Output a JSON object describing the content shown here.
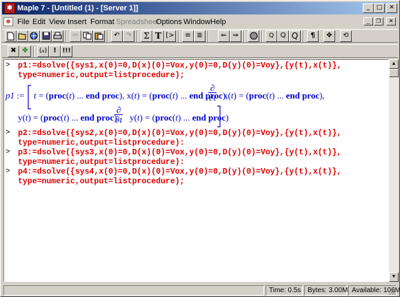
{
  "window": {
    "title": "Maple 7 - [Untitled (1) - [Server 1]]",
    "app_icon": "maple-leaf-icon"
  },
  "menu": [
    {
      "label": "File",
      "enabled": true
    },
    {
      "label": "Edit",
      "enabled": true
    },
    {
      "label": "View",
      "enabled": true
    },
    {
      "label": "Insert",
      "enabled": true
    },
    {
      "label": "Format",
      "enabled": true
    },
    {
      "label": "Spreadsheet",
      "enabled": false
    },
    {
      "label": "Options",
      "enabled": true
    },
    {
      "label": "Window",
      "enabled": true
    },
    {
      "label": "Help",
      "enabled": true
    }
  ],
  "toolbar": {
    "sigma": "Σ",
    "text_T": "T",
    "zoom1": "Q",
    "zoom2": "Q",
    "zoom3": "Q",
    "pilcrow": "¶"
  },
  "toolbar2": {
    "restart": "(𝓍)",
    "bang": "!",
    "triple_bang": "!!!"
  },
  "worksheet": {
    "prompt": ">",
    "cmd1a": "p1:=dsolve({sys1,x(0)=0,D(x)(0)=Vox,y(0)=0,D(y)(0)=Voy},{y(t),x(t)},",
    "cmd1b": "type=numeric,output=listprocedure);",
    "cmd2a": "p2:=dsolve({sys2,x(0)=0,D(x)(0)=Vox,y(0)=0,D(y)(0)=Voy},{y(t),x(t)},",
    "cmd2b": "type=numeric,output=listprocedure):",
    "cmd3a": "p3:=dsolve({sys3,x(0)=0,D(x)(0)=Vox,y(0)=0,D(y)(0)=Voy},{y(t),x(t)},",
    "cmd3b": "type=numeric,output=listprocedure):",
    "cmd4a": "p4:=dsolve({sys4,x(0)=0,D(x)(0)=Vox,y(0)=0,D(y)(0)=Voy},{y(t),x(t)},",
    "cmd4b": "type=numeric,output=listprocedure);",
    "out_name": "p1",
    "out_assign": ":=",
    "proc_text": "proc",
    "ellipsis": "...",
    "end_proc": "end proc",
    "var_t": "t",
    "fn_x": "x",
    "fn_y": "y",
    "partial": "∂"
  },
  "status": {
    "time": "Time:  0.5s",
    "bytes": "Bytes: 3.00M",
    "available": "Available: 106M"
  }
}
